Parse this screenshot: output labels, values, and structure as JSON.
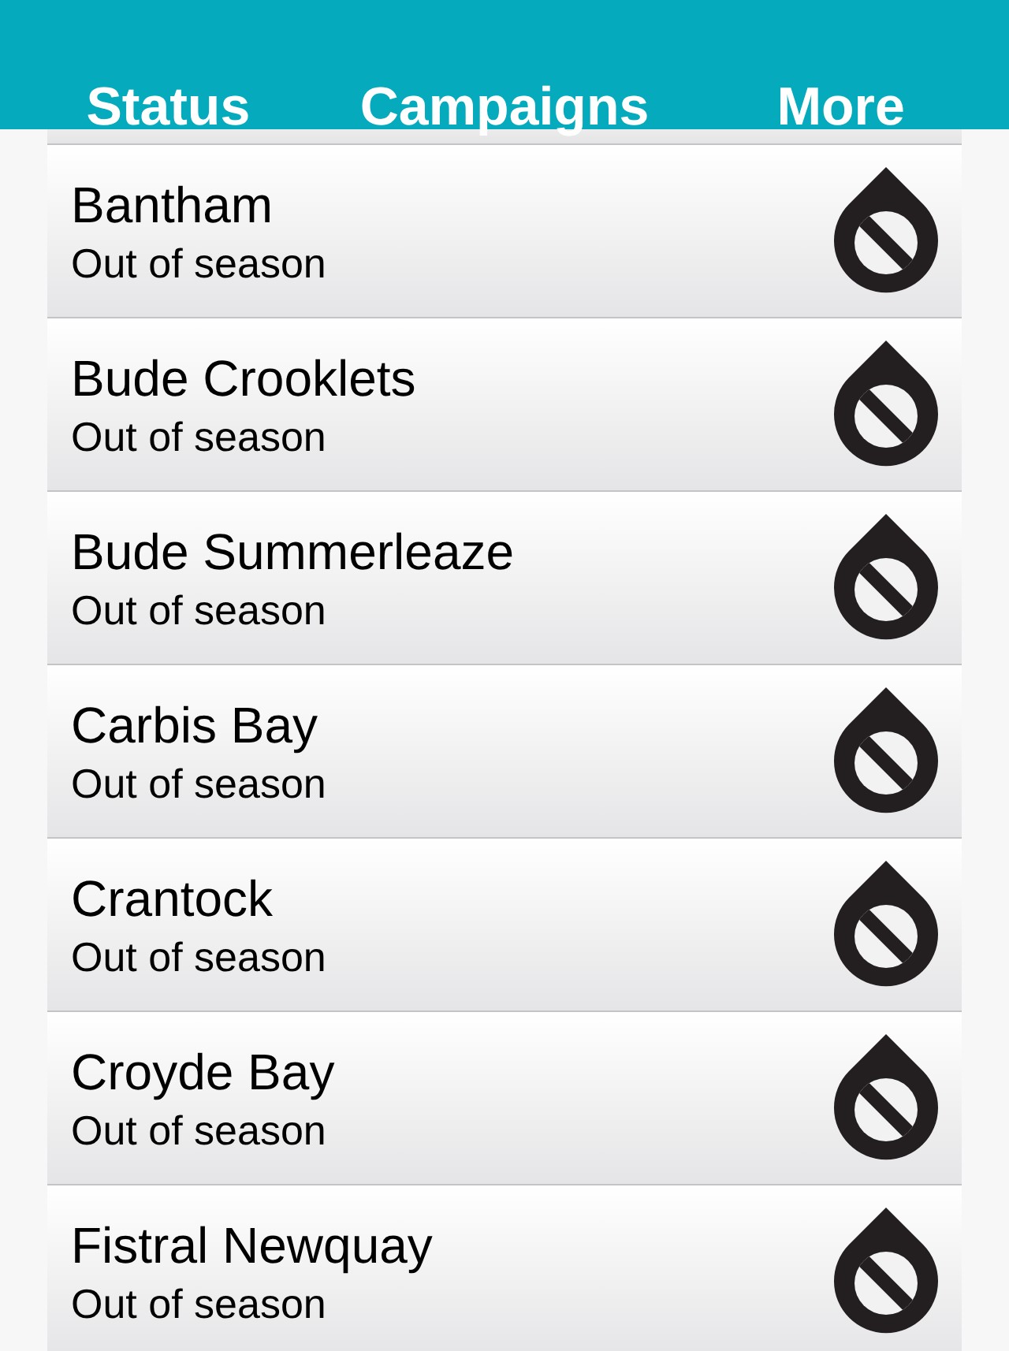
{
  "tabs": [
    {
      "label": "Status"
    },
    {
      "label": "Campaigns"
    },
    {
      "label": "More"
    }
  ],
  "beaches": [
    {
      "name": "Bantham",
      "status": "Out of season",
      "kind": "out_of_season"
    },
    {
      "name": "Bude Crooklets",
      "status": "Out of season",
      "kind": "out_of_season"
    },
    {
      "name": "Bude Summerleaze",
      "status": "Out of season",
      "kind": "out_of_season"
    },
    {
      "name": "Carbis Bay",
      "status": "Out of season",
      "kind": "out_of_season"
    },
    {
      "name": "Crantock",
      "status": "Out of season",
      "kind": "out_of_season"
    },
    {
      "name": "Croyde Bay",
      "status": "Out of season",
      "kind": "out_of_season"
    },
    {
      "name": "Fistral Newquay",
      "status": "Out of season",
      "kind": "out_of_season"
    }
  ]
}
